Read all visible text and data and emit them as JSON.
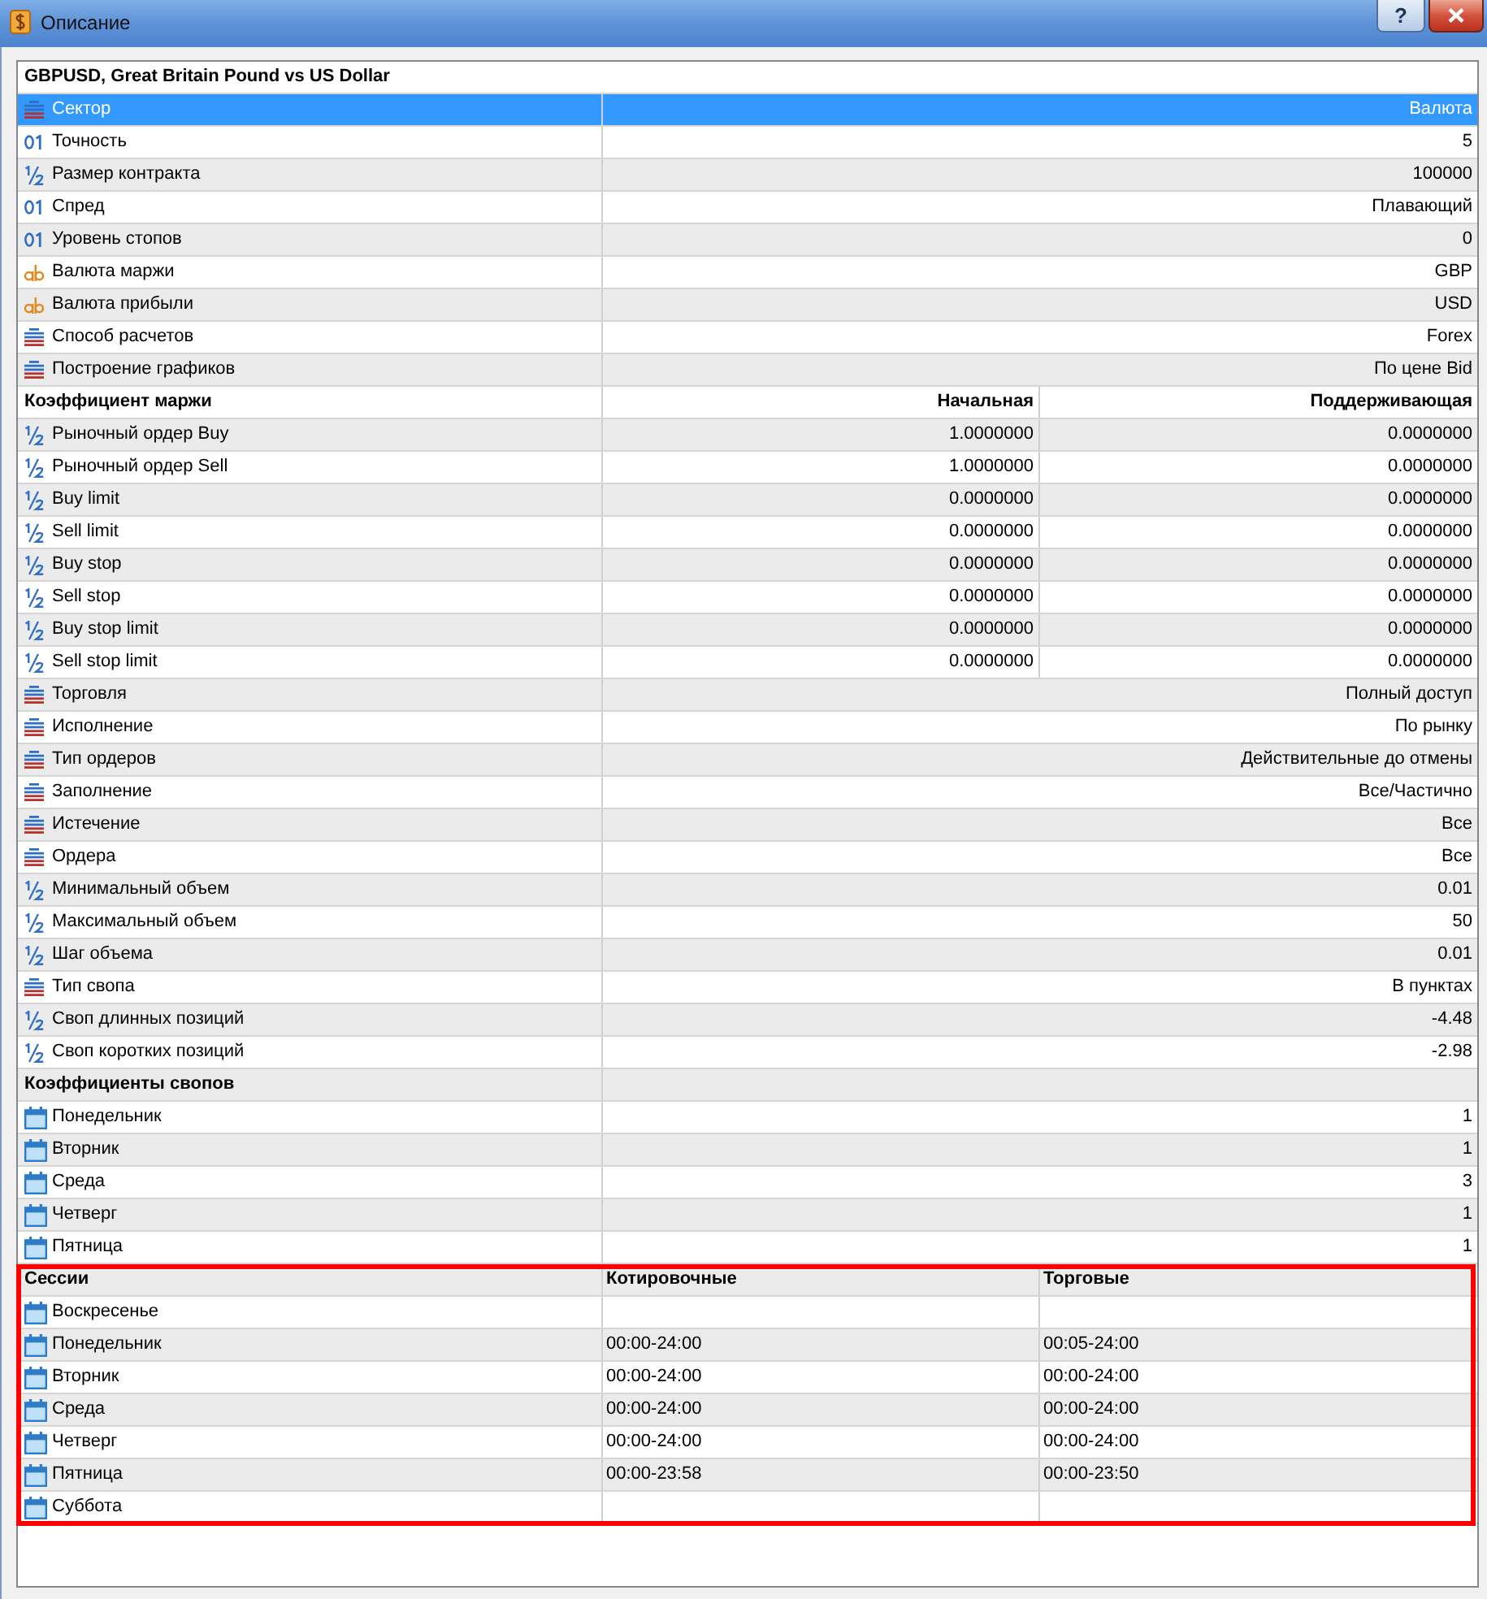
{
  "window": {
    "title": "Описание",
    "buttons": [
      {
        "kind": "help",
        "label": "?"
      },
      {
        "kind": "close"
      }
    ]
  },
  "table": {
    "title": "GBPUSD, Great Britain Pound vs US Dollar",
    "blocks": [
      {
        "kind": "properties",
        "rows": [
          {
            "label": "Сектор",
            "kind": "enum",
            "value": "Валюта",
            "selected": true
          },
          {
            "label": "Точность",
            "kind": "integer",
            "value": "5",
            "selected": false
          },
          {
            "label": "Размер контракта",
            "kind": "double",
            "value": "100000",
            "selected": false
          },
          {
            "label": "Спред",
            "kind": "integer",
            "value": "Плавающий",
            "selected": false
          },
          {
            "label": "Уровень стопов",
            "kind": "integer",
            "value": "0",
            "selected": false
          },
          {
            "label": "Валюта маржи",
            "kind": "string",
            "value": "GBP",
            "selected": false
          },
          {
            "label": "Валюта прибыли",
            "kind": "string",
            "value": "USD",
            "selected": false
          },
          {
            "label": "Способ расчетов",
            "kind": "enum",
            "value": "Forex",
            "selected": false
          },
          {
            "label": "Построение графиков",
            "kind": "enum",
            "value": "По цене Bid",
            "selected": false
          }
        ]
      },
      {
        "kind": "ratios",
        "heading": "Коэффициент маржи",
        "columns": [
          "Начальная",
          "Поддерживающая"
        ],
        "rows": [
          {
            "label": "Рыночный ордер Buy",
            "kind": "double",
            "values": [
              "1.0000000",
              "0.0000000"
            ],
            "selected": false
          },
          {
            "label": "Рыночный ордер Sell",
            "kind": "double",
            "values": [
              "1.0000000",
              "0.0000000"
            ],
            "selected": false
          },
          {
            "label": "Buy limit",
            "kind": "double",
            "values": [
              "0.0000000",
              "0.0000000"
            ],
            "selected": false
          },
          {
            "label": "Sell limit",
            "kind": "double",
            "values": [
              "0.0000000",
              "0.0000000"
            ],
            "selected": false
          },
          {
            "label": "Buy stop",
            "kind": "double",
            "values": [
              "0.0000000",
              "0.0000000"
            ],
            "selected": false
          },
          {
            "label": "Sell stop",
            "kind": "double",
            "values": [
              "0.0000000",
              "0.0000000"
            ],
            "selected": false
          },
          {
            "label": "Buy stop limit",
            "kind": "double",
            "values": [
              "0.0000000",
              "0.0000000"
            ],
            "selected": false
          },
          {
            "label": "Sell stop limit",
            "kind": "double",
            "values": [
              "0.0000000",
              "0.0000000"
            ],
            "selected": false
          }
        ]
      },
      {
        "kind": "properties",
        "rows": [
          {
            "label": "Торговля",
            "kind": "enum",
            "value": "Полный доступ",
            "selected": false
          },
          {
            "label": "Исполнение",
            "kind": "enum",
            "value": "По рынку",
            "selected": false
          },
          {
            "label": "Тип ордеров",
            "kind": "enum",
            "value": "Действительные до отмены",
            "selected": false
          },
          {
            "label": "Заполнение",
            "kind": "enum",
            "value": "Все/Частично",
            "selected": false
          },
          {
            "label": "Истечение",
            "kind": "enum",
            "value": "Все",
            "selected": false
          },
          {
            "label": "Ордера",
            "kind": "enum",
            "value": "Все",
            "selected": false
          },
          {
            "label": "Минимальный объем",
            "kind": "double",
            "value": "0.01",
            "selected": false
          },
          {
            "label": "Максимальный объем",
            "kind": "double",
            "value": "50",
            "selected": false
          },
          {
            "label": "Шаг объема",
            "kind": "double",
            "value": "0.01",
            "selected": false
          },
          {
            "label": "Тип свопа",
            "kind": "enum",
            "value": "В пунктах",
            "selected": false
          },
          {
            "label": "Своп длинных позиций",
            "kind": "double",
            "value": "-4.48",
            "selected": false
          },
          {
            "label": "Своп коротких позиций",
            "kind": "double",
            "value": "-2.98",
            "selected": false
          }
        ]
      },
      {
        "kind": "properties",
        "heading": "Коэффициенты свопов",
        "rows": [
          {
            "label": "Понедельник",
            "kind": "date",
            "value": "1",
            "selected": false
          },
          {
            "label": "Вторник",
            "kind": "date",
            "value": "1",
            "selected": false
          },
          {
            "label": "Среда",
            "kind": "date",
            "value": "3",
            "selected": false
          },
          {
            "label": "Четверг",
            "kind": "date",
            "value": "1",
            "selected": false
          },
          {
            "label": "Пятница",
            "kind": "date",
            "value": "1",
            "selected": false
          }
        ]
      },
      {
        "kind": "sessions",
        "heading": "Сессии",
        "columns": [
          "Котировочные",
          "Торговые"
        ],
        "highlighted": true,
        "rows": [
          {
            "label": "Воскресенье",
            "kind": "date",
            "selected": false
          },
          {
            "label": "Понедельник",
            "kind": "date",
            "values": [
              "00:00-24:00",
              "00:05-24:00"
            ],
            "selected": false
          },
          {
            "label": "Вторник",
            "kind": "date",
            "values": [
              "00:00-24:00",
              "00:00-24:00"
            ],
            "selected": false
          },
          {
            "label": "Среда",
            "kind": "date",
            "values": [
              "00:00-24:00",
              "00:00-24:00"
            ],
            "selected": false
          },
          {
            "label": "Четверг",
            "kind": "date",
            "values": [
              "00:00-24:00",
              "00:00-24:00"
            ],
            "selected": false
          },
          {
            "label": "Пятница",
            "kind": "date",
            "values": [
              "00:00-23:58",
              "00:00-23:50"
            ],
            "selected": false
          },
          {
            "label": "Суббота",
            "kind": "date",
            "selected": false
          }
        ]
      }
    ]
  }
}
